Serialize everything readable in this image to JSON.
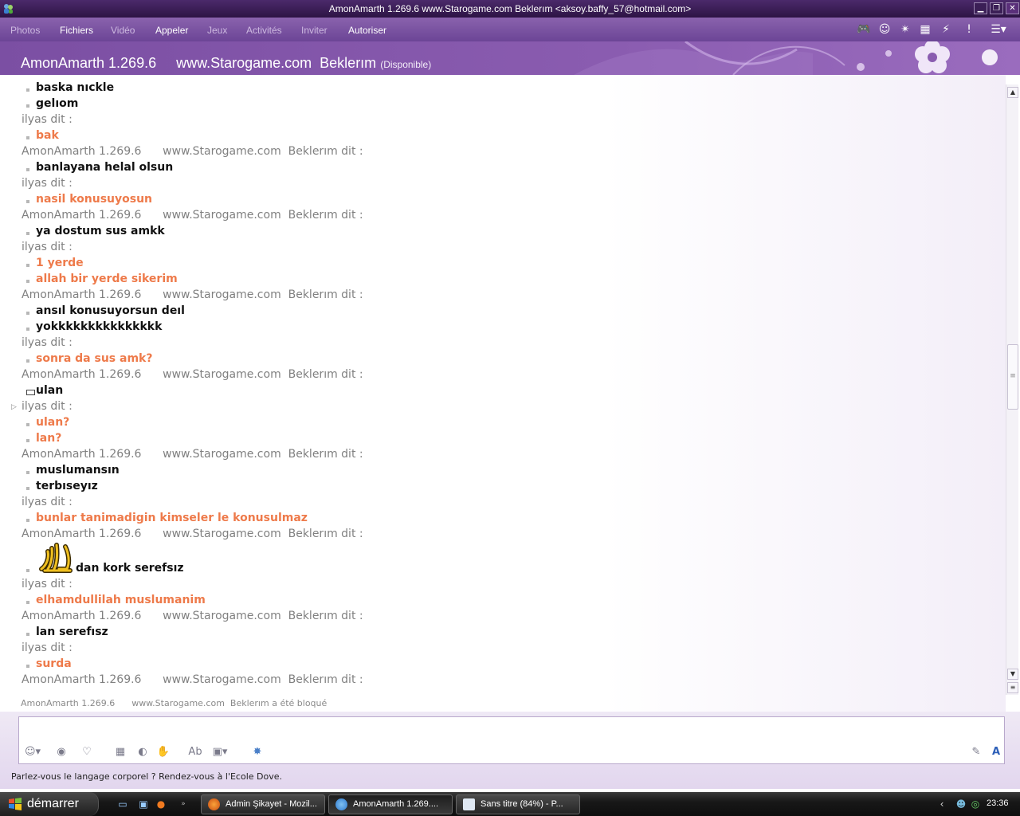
{
  "window": {
    "title": "AmonAmarth 1.269.6       www.Starogame.com  Beklerım <aksoy.baffy_57@hotmail.com>"
  },
  "menu": {
    "items": [
      "Photos",
      "Fichiers",
      "Vidéo",
      "Appeler",
      "Jeux",
      "Activités",
      "Inviter",
      "Autoriser"
    ],
    "enabled": [
      false,
      true,
      false,
      true,
      false,
      false,
      false,
      true
    ]
  },
  "header": {
    "contact_name": "AmonAmarth 1.269.6     www.Starogame.com  Beklerım",
    "status": "(Disponible)"
  },
  "conversation": [
    {
      "kind": "msg",
      "who": "me",
      "text": "baska nıckle"
    },
    {
      "kind": "msg",
      "who": "me",
      "text": "gelıom"
    },
    {
      "kind": "sender",
      "text": "ilyas dit :"
    },
    {
      "kind": "msg",
      "who": "other",
      "text": "bak"
    },
    {
      "kind": "sender",
      "text": "AmonAmarth 1.269.6      www.Starogame.com  Beklerım dit :"
    },
    {
      "kind": "msg",
      "who": "me",
      "text": "banlayana helal olsun"
    },
    {
      "kind": "sender",
      "text": "ilyas dit :"
    },
    {
      "kind": "msg",
      "who": "other",
      "text": "nasil konusuyosun"
    },
    {
      "kind": "sender",
      "text": "AmonAmarth 1.269.6      www.Starogame.com  Beklerım dit :"
    },
    {
      "kind": "msg",
      "who": "me",
      "text": "ya dostum sus amkk"
    },
    {
      "kind": "sender",
      "text": "ilyas dit :"
    },
    {
      "kind": "msg",
      "who": "other",
      "text": "1 yerde"
    },
    {
      "kind": "msg",
      "who": "other",
      "text": "allah bir yerde sikerim"
    },
    {
      "kind": "sender",
      "text": "AmonAmarth 1.269.6      www.Starogame.com  Beklerım dit :"
    },
    {
      "kind": "msg",
      "who": "me",
      "text": "ansıl konusuyorsun deıl"
    },
    {
      "kind": "msg",
      "who": "me",
      "text": "yokkkkkkkkkkkkkkk"
    },
    {
      "kind": "sender",
      "text": "ilyas dit :"
    },
    {
      "kind": "msg",
      "who": "other",
      "text": "sonra da sus amk?"
    },
    {
      "kind": "sender",
      "text": "AmonAmarth 1.269.6      www.Starogame.com  Beklerım dit :"
    },
    {
      "kind": "msg",
      "who": "me",
      "text": "ulan",
      "box": true
    },
    {
      "kind": "sender",
      "text": "ilyas dit :"
    },
    {
      "kind": "msg",
      "who": "other",
      "text": "ulan?"
    },
    {
      "kind": "msg",
      "who": "other",
      "text": "lan?"
    },
    {
      "kind": "sender",
      "text": "AmonAmarth 1.269.6      www.Starogame.com  Beklerım dit :"
    },
    {
      "kind": "msg",
      "who": "me",
      "text": "muslumansın"
    },
    {
      "kind": "msg",
      "who": "me",
      "text": "terbıseyız"
    },
    {
      "kind": "sender",
      "text": "ilyas dit :"
    },
    {
      "kind": "msg",
      "who": "other",
      "text": "bunlar tanimadigin kimseler le konusulmaz"
    },
    {
      "kind": "sender",
      "text": "AmonAmarth 1.269.6      www.Starogame.com  Beklerım dit :"
    },
    {
      "kind": "emoticon-msg",
      "who": "me",
      "text": "dan kork serefsız"
    },
    {
      "kind": "sender",
      "text": "ilyas dit :"
    },
    {
      "kind": "msg",
      "who": "other",
      "text": "elhamdullilah muslumanim"
    },
    {
      "kind": "sender",
      "text": "AmonAmarth 1.269.6      www.Starogame.com  Beklerım dit :"
    },
    {
      "kind": "msg",
      "who": "me",
      "text": "lan serefısz"
    },
    {
      "kind": "sender",
      "text": "ilyas dit :"
    },
    {
      "kind": "msg",
      "who": "other",
      "text": "surda"
    },
    {
      "kind": "sender",
      "text": "AmonAmarth 1.269.6      www.Starogame.com  Beklerım dit :"
    }
  ],
  "blocked_notice": "AmonAmarth 1.269.6      www.Starogame.com  Beklerım a été bloqué",
  "compose": {
    "value": "",
    "promo": "Parlez-vous le langage corporel ? Rendez-vous à l'Ecole Dove."
  },
  "taskbar": {
    "start_label": "démarrer",
    "tasks": [
      "Admin Şikayet - Mozil...",
      "AmonAmarth 1.269....",
      "Sans titre (84%) - P..."
    ],
    "clock": "23:36"
  },
  "colors": {
    "accent": "#7b4fa3",
    "my_text": "#111111",
    "other_text": "#ee7a4a",
    "sender_text": "#808080"
  },
  "icons": {
    "toolbar": [
      "game-icon",
      "smiley-icon",
      "wink-icon",
      "phone-icon",
      "nudge-icon",
      "alert-icon",
      "menu-icon"
    ],
    "compose": [
      "emoticon-icon",
      "voice-clip-icon",
      "wink-icon",
      "background-icon",
      "games-icon",
      "handwriting-icon",
      "font-icon",
      "format-icon",
      "settings-icon",
      "pen-icon",
      "text-style-icon"
    ]
  }
}
